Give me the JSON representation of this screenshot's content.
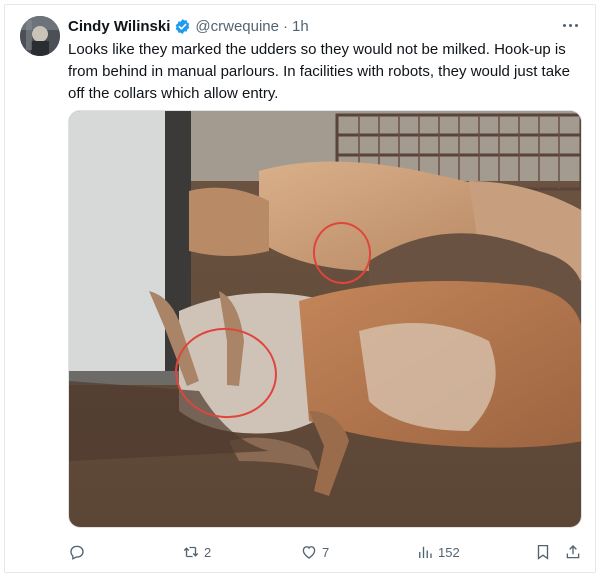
{
  "tweet": {
    "display_name": "Cindy Wilinski",
    "handle": "@crwequine",
    "separator": "·",
    "time": "1h",
    "verified_color": "#1d9bf0",
    "text": "Looks like they marked the udders so they would not be milked. Hook-up is from behind in manual parlours. In facilities with robots, they would just take off the collars which allow entry.",
    "media": {
      "alt_kind": "photo",
      "annotation_color": "#e0453c"
    }
  },
  "actions": {
    "reply": {
      "icon": "reply-icon",
      "count": ""
    },
    "retweet": {
      "icon": "retweet-icon",
      "count": "2"
    },
    "like": {
      "icon": "heart-icon",
      "count": "7"
    },
    "views": {
      "icon": "views-icon",
      "count": "152"
    },
    "bookmark": {
      "icon": "bookmark-icon"
    },
    "share": {
      "icon": "share-icon"
    }
  },
  "colors": {
    "text_primary": "#0f1419",
    "text_secondary": "#536471",
    "border": "#e6e9ec"
  }
}
